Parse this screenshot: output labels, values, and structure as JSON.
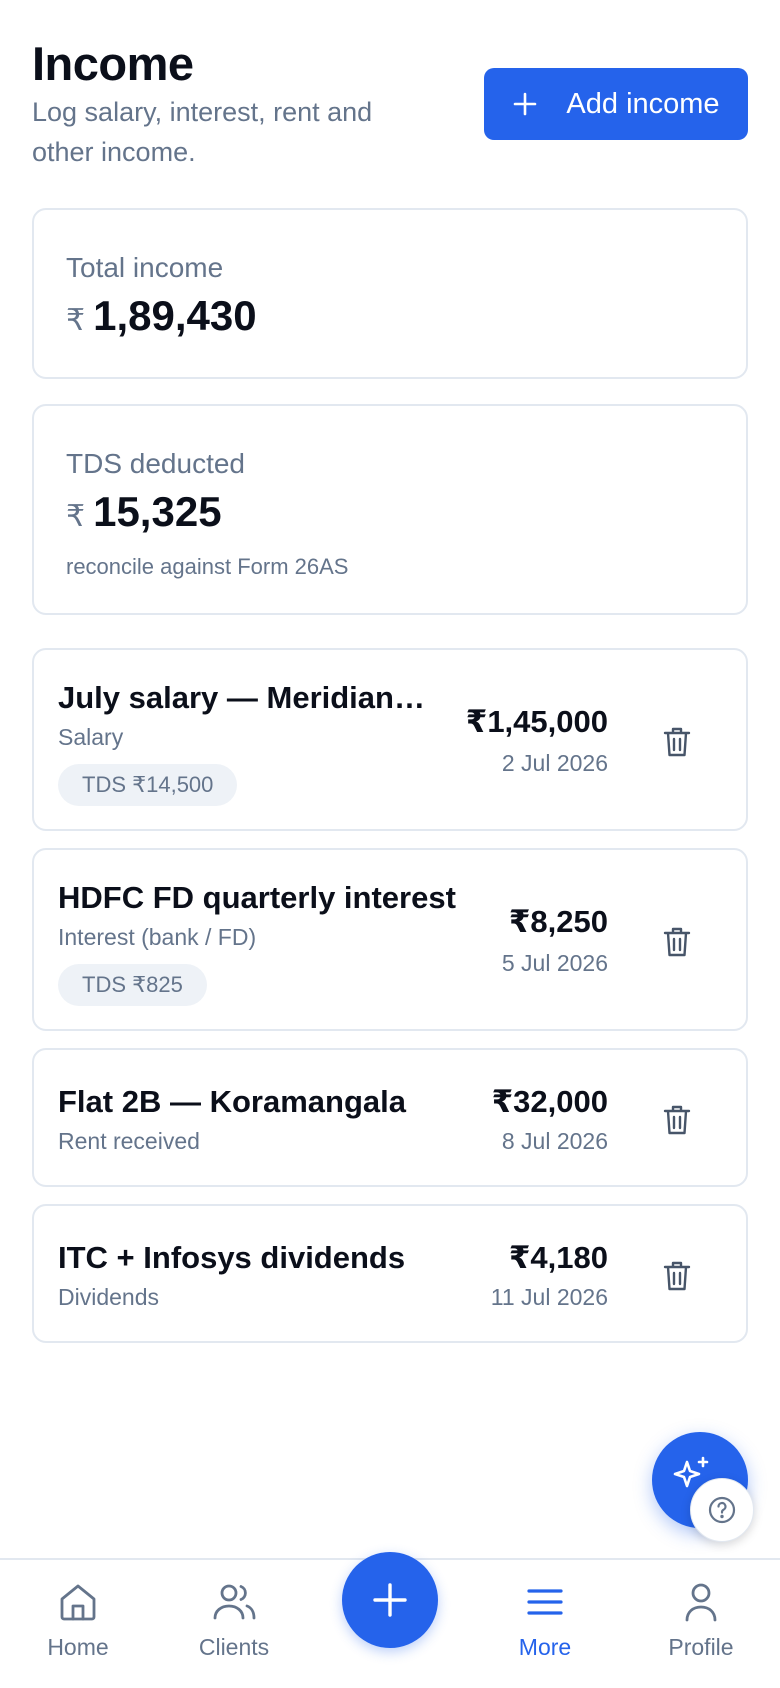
{
  "header": {
    "title": "Income",
    "subtitle": "Log salary, interest, rent and other income.",
    "add_button_label": "Add income"
  },
  "stats": {
    "total": {
      "label": "Total income",
      "currency": "₹",
      "value": "1,89,430"
    },
    "tds": {
      "label": "TDS deducted",
      "currency": "₹",
      "value": "15,325",
      "note": "reconcile against Form 26AS"
    }
  },
  "incomes": [
    {
      "title": "July salary — Meridian Technologies",
      "category": "Salary",
      "badge": "TDS ₹14,500",
      "amount": "₹1,45,000",
      "date": "2 Jul 2026"
    },
    {
      "title": "HDFC FD quarterly interest",
      "category": "Interest (bank / FD)",
      "badge": "TDS ₹825",
      "amount": "₹8,250",
      "date": "5 Jul 2026"
    },
    {
      "title": "Flat 2B — Koramangala",
      "category": "Rent received",
      "amount": "₹32,000",
      "date": "8 Jul 2026"
    },
    {
      "title": "ITC + Infosys dividends",
      "category": "Dividends",
      "amount": "₹4,180",
      "date": "11 Jul 2026"
    }
  ],
  "nav": {
    "home": "Home",
    "clients": "Clients",
    "more": "More",
    "profile": "Profile"
  },
  "colors": {
    "accent": "#2563eb",
    "muted_text": "#64748b",
    "border": "#e2e8f0"
  },
  "icons": {
    "add": "plus-icon",
    "delete": "trash-icon",
    "ai": "sparkles-icon",
    "help": "question-icon",
    "home": "home-icon",
    "clients": "users-icon",
    "more": "menu-icon",
    "profile": "user-icon"
  }
}
